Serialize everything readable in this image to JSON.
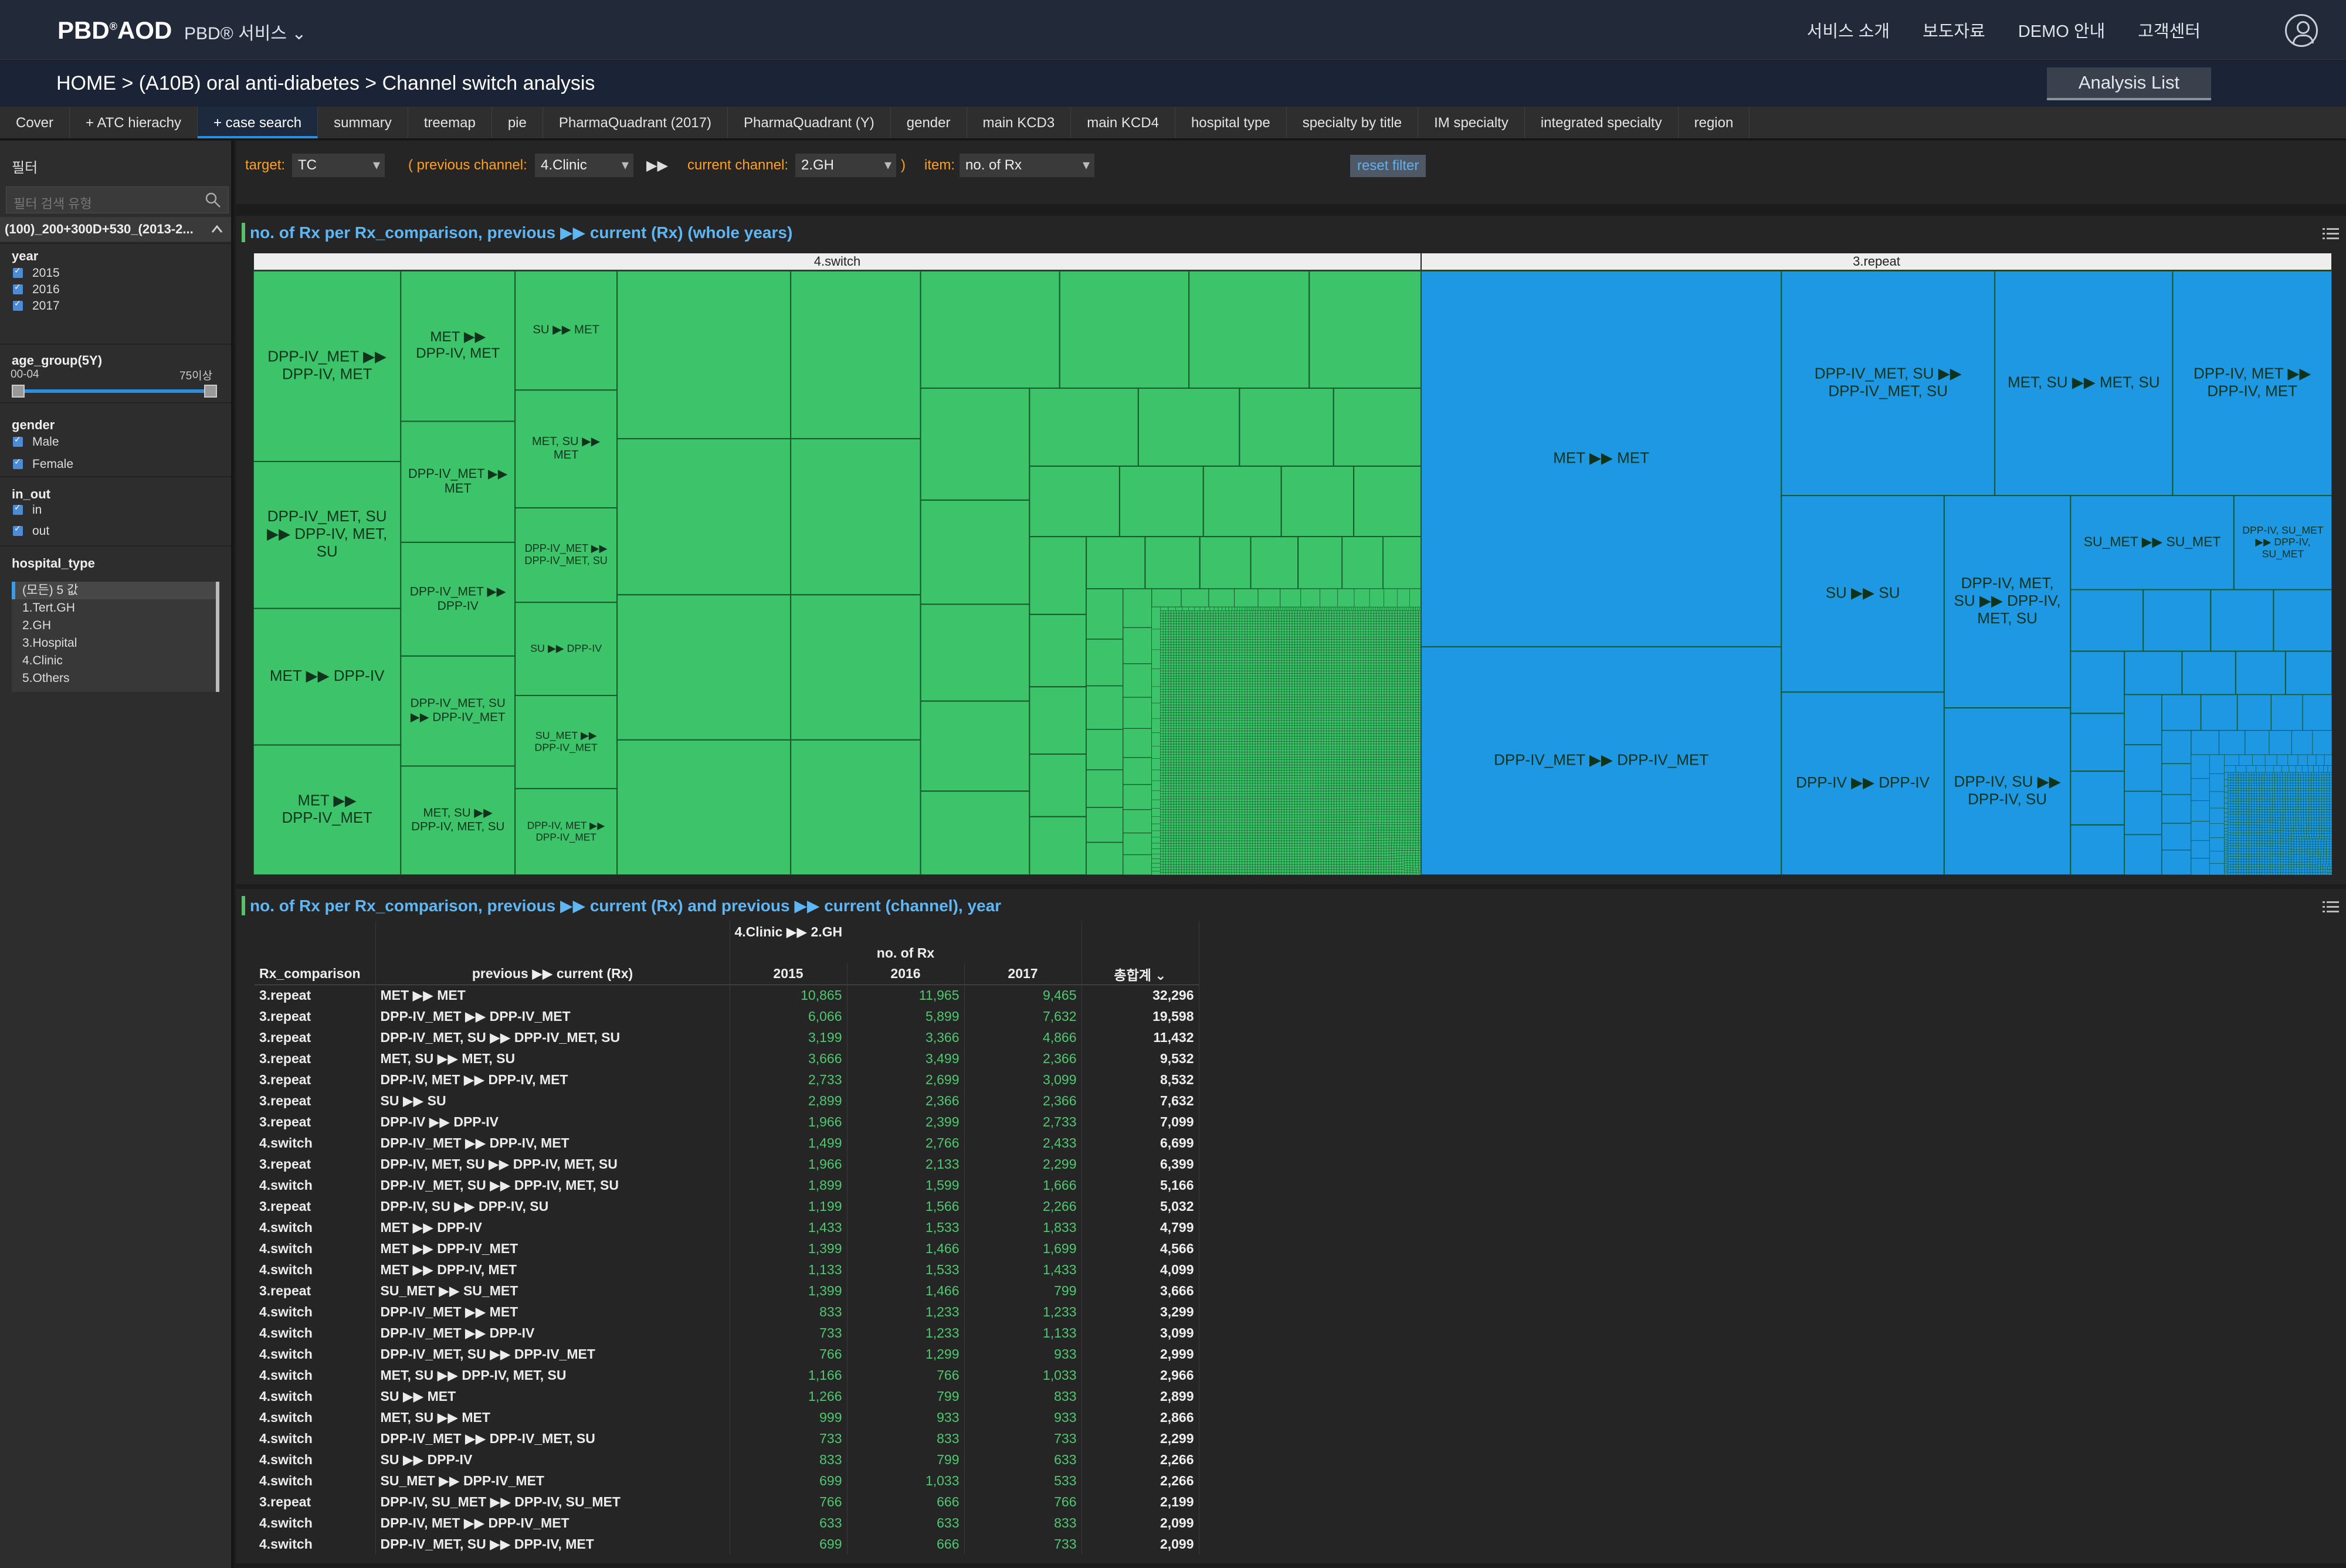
{
  "header": {
    "logo_main": "PBD",
    "logo_mark": "®",
    "logo_tail": "AOD",
    "service_menu": "PBD® 서비스",
    "nav": [
      "서비스 소개",
      "보도자료",
      "DEMO 안내",
      "고객센터"
    ]
  },
  "breadcrumb": "HOME > (A10B) oral anti-diabetes > Channel switch analysis",
  "analysis_list_label": "Analysis List",
  "tabs": [
    "Cover",
    "+ ATC hierachy",
    "+ case search",
    "summary",
    "treemap",
    "pie",
    "PharmaQuadrant (2017)",
    "PharmaQuadrant (Y)",
    "gender",
    "main KCD3",
    "main KCD4",
    "hospital type",
    "specialty by title",
    "IM specialty",
    "integrated specialty",
    "region"
  ],
  "active_tab": "+ case search",
  "sidebar": {
    "title": "필터",
    "search_placeholder": "필터 검색 유형",
    "selected_filter": "(100)_200+300D+530_(2013-2...",
    "year": {
      "label": "year",
      "options": [
        "2015",
        "2016",
        "2017"
      ]
    },
    "age_group": {
      "label": "age_group(5Y)",
      "min_label": "00-04",
      "max_label": "75이상",
      "range": [
        0,
        1
      ]
    },
    "gender": {
      "label": "gender",
      "options": [
        "Male",
        "Female"
      ]
    },
    "in_out": {
      "label": "in_out",
      "options": [
        "in",
        "out"
      ]
    },
    "hospital_type": {
      "label": "hospital_type",
      "options": [
        "(모든) 5 값",
        "1.Tert.GH",
        "2.GH",
        "3.Hospital",
        "4.Clinic",
        "5.Others"
      ],
      "selected": "(모든) 5 값"
    }
  },
  "filterbar": {
    "target_label": "target:",
    "target_value": "TC",
    "prev_label": "( previous channel:",
    "prev_value": "4.Clinic",
    "arrow": "▶▶",
    "curr_label": "current channel:",
    "curr_value": "2.GH",
    "close_paren": ")",
    "item_label": "item:",
    "item_value": "no. of Rx",
    "reset_label": "reset filter"
  },
  "treemap_title": "no. of Rx per Rx_comparison, previous ▶▶ current (Rx) (whole years)",
  "table_title": "no. of Rx per Rx_comparison, previous ▶▶ current (Rx) and previous ▶▶ current (channel), year",
  "chart_data": {
    "type": "treemap",
    "groups": [
      {
        "name": "4.switch",
        "color": "#3dc46a",
        "value": 168200,
        "top_cells": [
          {
            "label": "DPP-IV_MET ▶▶ DPP-IV, MET",
            "value": 6699
          },
          {
            "label": "DPP-IV_MET, SU ▶▶ DPP-IV, MET, SU",
            "value": 5166
          },
          {
            "label": "MET ▶▶ DPP-IV",
            "value": 4799
          },
          {
            "label": "MET ▶▶ DPP-IV_MET",
            "value": 4566
          },
          {
            "label": "MET ▶▶ DPP-IV, MET",
            "value": 4099
          },
          {
            "label": "DPP-IV_MET ▶▶ MET",
            "value": 3299
          },
          {
            "label": "DPP-IV_MET ▶▶ DPP-IV",
            "value": 3099
          },
          {
            "label": "DPP-IV_MET, SU ▶▶ DPP-IV_MET",
            "value": 2999
          },
          {
            "label": "MET, SU ▶▶ DPP-IV, MET, SU",
            "value": 2966
          },
          {
            "label": "SU ▶▶ MET",
            "value": 2899
          },
          {
            "label": "MET, SU ▶▶ MET",
            "value": 2866
          },
          {
            "label": "DPP-IV_MET ▶▶ DPP-IV_MET, SU",
            "value": 2299
          },
          {
            "label": "SU ▶▶ DPP-IV",
            "value": 2266
          },
          {
            "label": "SU_MET ▶▶ DPP-IV_MET",
            "value": 2266
          },
          {
            "label": "DPP-IV, MET ▶▶ DPP-IV_MET",
            "value": 2099
          }
        ]
      },
      {
        "name": "3.repeat",
        "color": "#1e98e3",
        "value": 131200,
        "top_cells": [
          {
            "label": "MET ▶▶ MET",
            "value": 32296
          },
          {
            "label": "DPP-IV_MET ▶▶ DPP-IV_MET",
            "value": 19598
          },
          {
            "label": "DPP-IV_MET, SU ▶▶ DPP-IV_MET, SU",
            "value": 11432
          },
          {
            "label": "MET, SU ▶▶ MET, SU",
            "value": 9532
          },
          {
            "label": "DPP-IV, MET ▶▶ DPP-IV, MET",
            "value": 8532
          },
          {
            "label": "SU ▶▶ SU",
            "value": 7632
          },
          {
            "label": "DPP-IV ▶▶ DPP-IV",
            "value": 7099
          },
          {
            "label": "DPP-IV, MET, SU ▶▶ DPP-IV, MET, SU",
            "value": 6399
          },
          {
            "label": "DPP-IV, SU ▶▶ DPP-IV, SU",
            "value": 5032
          },
          {
            "label": "SU_MET ▶▶ SU_MET",
            "value": 3666
          },
          {
            "label": "DPP-IV, SU_MET ▶▶ DPP-IV, SU_MET",
            "value": 2199
          }
        ]
      }
    ]
  },
  "table": {
    "channel_header": "4.Clinic ▶▶ 2.GH",
    "measure_header": "no. of Rx",
    "headers": [
      "Rx_comparison",
      "previous ▶▶ current (Rx)",
      "2015",
      "2016",
      "2017",
      "총합계"
    ],
    "rows": [
      [
        "3.repeat",
        "MET ▶▶ MET",
        "10,865",
        "11,965",
        "9,465",
        "32,296"
      ],
      [
        "3.repeat",
        "DPP-IV_MET ▶▶ DPP-IV_MET",
        "6,066",
        "5,899",
        "7,632",
        "19,598"
      ],
      [
        "3.repeat",
        "DPP-IV_MET, SU ▶▶ DPP-IV_MET, SU",
        "3,199",
        "3,366",
        "4,866",
        "11,432"
      ],
      [
        "3.repeat",
        "MET, SU ▶▶ MET, SU",
        "3,666",
        "3,499",
        "2,366",
        "9,532"
      ],
      [
        "3.repeat",
        "DPP-IV, MET ▶▶ DPP-IV, MET",
        "2,733",
        "2,699",
        "3,099",
        "8,532"
      ],
      [
        "3.repeat",
        "SU ▶▶ SU",
        "2,899",
        "2,366",
        "2,366",
        "7,632"
      ],
      [
        "3.repeat",
        "DPP-IV ▶▶ DPP-IV",
        "1,966",
        "2,399",
        "2,733",
        "7,099"
      ],
      [
        "4.switch",
        "DPP-IV_MET ▶▶ DPP-IV, MET",
        "1,499",
        "2,766",
        "2,433",
        "6,699"
      ],
      [
        "3.repeat",
        "DPP-IV, MET, SU ▶▶ DPP-IV, MET, SU",
        "1,966",
        "2,133",
        "2,299",
        "6,399"
      ],
      [
        "4.switch",
        "DPP-IV_MET, SU ▶▶ DPP-IV, MET, SU",
        "1,899",
        "1,599",
        "1,666",
        "5,166"
      ],
      [
        "3.repeat",
        "DPP-IV, SU ▶▶ DPP-IV, SU",
        "1,199",
        "1,566",
        "2,266",
        "5,032"
      ],
      [
        "4.switch",
        "MET ▶▶ DPP-IV",
        "1,433",
        "1,533",
        "1,833",
        "4,799"
      ],
      [
        "4.switch",
        "MET ▶▶ DPP-IV_MET",
        "1,399",
        "1,466",
        "1,699",
        "4,566"
      ],
      [
        "4.switch",
        "MET ▶▶ DPP-IV, MET",
        "1,133",
        "1,533",
        "1,433",
        "4,099"
      ],
      [
        "3.repeat",
        "SU_MET ▶▶ SU_MET",
        "1,399",
        "1,466",
        "799",
        "3,666"
      ],
      [
        "4.switch",
        "DPP-IV_MET ▶▶ MET",
        "833",
        "1,233",
        "1,233",
        "3,299"
      ],
      [
        "4.switch",
        "DPP-IV_MET ▶▶ DPP-IV",
        "733",
        "1,233",
        "1,133",
        "3,099"
      ],
      [
        "4.switch",
        "DPP-IV_MET, SU ▶▶ DPP-IV_MET",
        "766",
        "1,299",
        "933",
        "2,999"
      ],
      [
        "4.switch",
        "MET, SU ▶▶ DPP-IV, MET, SU",
        "1,166",
        "766",
        "1,033",
        "2,966"
      ],
      [
        "4.switch",
        "SU ▶▶ MET",
        "1,266",
        "799",
        "833",
        "2,899"
      ],
      [
        "4.switch",
        "MET, SU ▶▶ MET",
        "999",
        "933",
        "933",
        "2,866"
      ],
      [
        "4.switch",
        "DPP-IV_MET ▶▶ DPP-IV_MET, SU",
        "733",
        "833",
        "733",
        "2,299"
      ],
      [
        "4.switch",
        "SU ▶▶ DPP-IV",
        "833",
        "799",
        "633",
        "2,266"
      ],
      [
        "4.switch",
        "SU_MET ▶▶ DPP-IV_MET",
        "699",
        "1,033",
        "533",
        "2,266"
      ],
      [
        "3.repeat",
        "DPP-IV, SU_MET ▶▶ DPP-IV, SU_MET",
        "766",
        "666",
        "766",
        "2,199"
      ],
      [
        "4.switch",
        "DPP-IV, MET ▶▶ DPP-IV_MET",
        "633",
        "633",
        "833",
        "2,099"
      ],
      [
        "4.switch",
        "DPP-IV_MET, SU ▶▶ DPP-IV, MET",
        "699",
        "666",
        "733",
        "2,099"
      ]
    ]
  }
}
